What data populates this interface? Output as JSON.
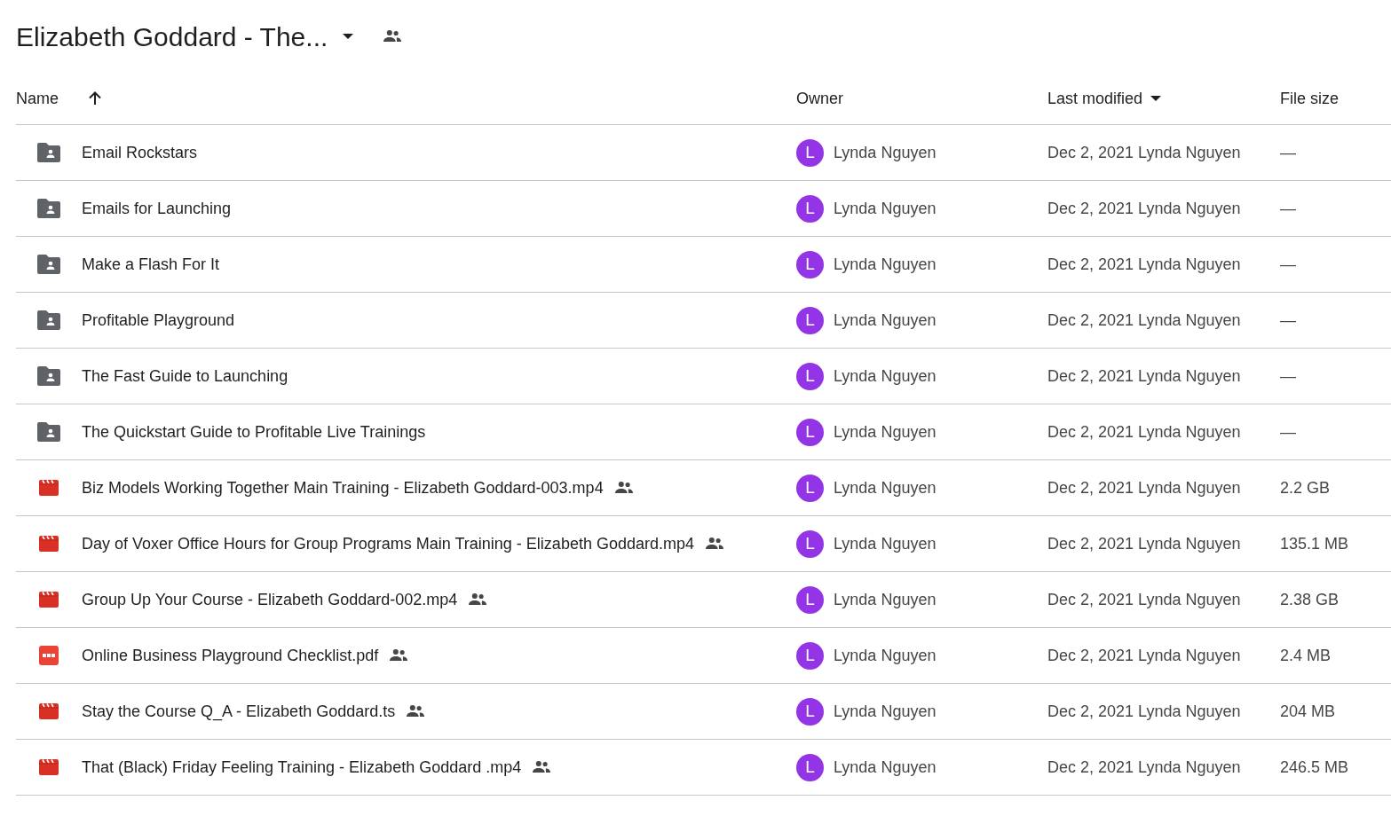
{
  "title": "Elizabeth Goddard - The...",
  "columns": [
    {
      "label": "Name",
      "kind": "arrow"
    },
    {
      "label": "Owner",
      "kind": "plain"
    },
    {
      "label": "Last modified",
      "kind": "caret"
    },
    {
      "label": "File size",
      "kind": "plain"
    }
  ],
  "rows": [
    {
      "kind": "folder",
      "name": "Email Rockstars",
      "shared": false,
      "owner_initial": "L",
      "color": "#9334e6",
      "owner": "Lynda Nguyen",
      "modified": "Dec 2, 2021 Lynda Nguyen",
      "size": "—"
    },
    {
      "kind": "folder",
      "name": "Emails for Launching",
      "shared": false,
      "owner_initial": "L",
      "color": "#9334e6",
      "owner": "Lynda Nguyen",
      "modified": "Dec 2, 2021 Lynda Nguyen",
      "size": "—"
    },
    {
      "kind": "folder",
      "name": "Make a Flash For It",
      "shared": false,
      "owner_initial": "L",
      "color": "#9334e6",
      "owner": "Lynda Nguyen",
      "modified": "Dec 2, 2021 Lynda Nguyen",
      "size": "—"
    },
    {
      "kind": "folder",
      "name": "Profitable Playground",
      "shared": false,
      "owner_initial": "L",
      "color": "#9334e6",
      "owner": "Lynda Nguyen",
      "modified": "Dec 2, 2021 Lynda Nguyen",
      "size": "—"
    },
    {
      "kind": "folder",
      "name": "The Fast Guide to Launching",
      "shared": false,
      "owner_initial": "L",
      "color": "#9334e6",
      "owner": "Lynda Nguyen",
      "modified": "Dec 2, 2021 Lynda Nguyen",
      "size": "—"
    },
    {
      "kind": "folder",
      "name": "The Quickstart Guide to Profitable Live Trainings",
      "shared": false,
      "owner_initial": "L",
      "color": "#9334e6",
      "owner": "Lynda Nguyen",
      "modified": "Dec 2, 2021 Lynda Nguyen",
      "size": "—"
    },
    {
      "kind": "video",
      "name": "Biz Models Working Together Main Training - Elizabeth Goddard-003.mp4",
      "shared": true,
      "owner_initial": "L",
      "color": "#9334e6",
      "owner": "Lynda Nguyen",
      "modified": "Dec 2, 2021 Lynda Nguyen",
      "size": "2.2 GB"
    },
    {
      "kind": "video",
      "name": "Day of Voxer Office Hours for Group Programs Main Training - Elizabeth Goddard.mp4",
      "shared": true,
      "owner_initial": "L",
      "color": "#9334e6",
      "owner": "Lynda Nguyen",
      "modified": "Dec 2, 2021 Lynda Nguyen",
      "size": "135.1 MB"
    },
    {
      "kind": "video",
      "name": "Group Up Your Course - Elizabeth Goddard-002.mp4",
      "shared": true,
      "owner_initial": "L",
      "color": "#9334e6",
      "owner": "Lynda Nguyen",
      "modified": "Dec 2, 2021 Lynda Nguyen",
      "size": "2.38 GB"
    },
    {
      "kind": "pdf",
      "name": "Online Business Playground Checklist.pdf",
      "shared": true,
      "owner_initial": "L",
      "color": "#9334e6",
      "owner": "Lynda Nguyen",
      "modified": "Dec 2, 2021 Lynda Nguyen",
      "size": "2.4 MB"
    },
    {
      "kind": "video",
      "name": "Stay the Course Q_A - Elizabeth Goddard.ts",
      "shared": true,
      "owner_initial": "L",
      "color": "#9334e6",
      "owner": "Lynda Nguyen",
      "modified": "Dec 2, 2021 Lynda Nguyen",
      "size": "204 MB"
    },
    {
      "kind": "video",
      "name": "That (Black) Friday Feeling Training - Elizabeth Goddard .mp4",
      "shared": true,
      "owner_initial": "L",
      "color": "#9334e6",
      "owner": "Lynda Nguyen",
      "modified": "Dec 2, 2021 Lynda Nguyen",
      "size": "246.5 MB"
    }
  ]
}
